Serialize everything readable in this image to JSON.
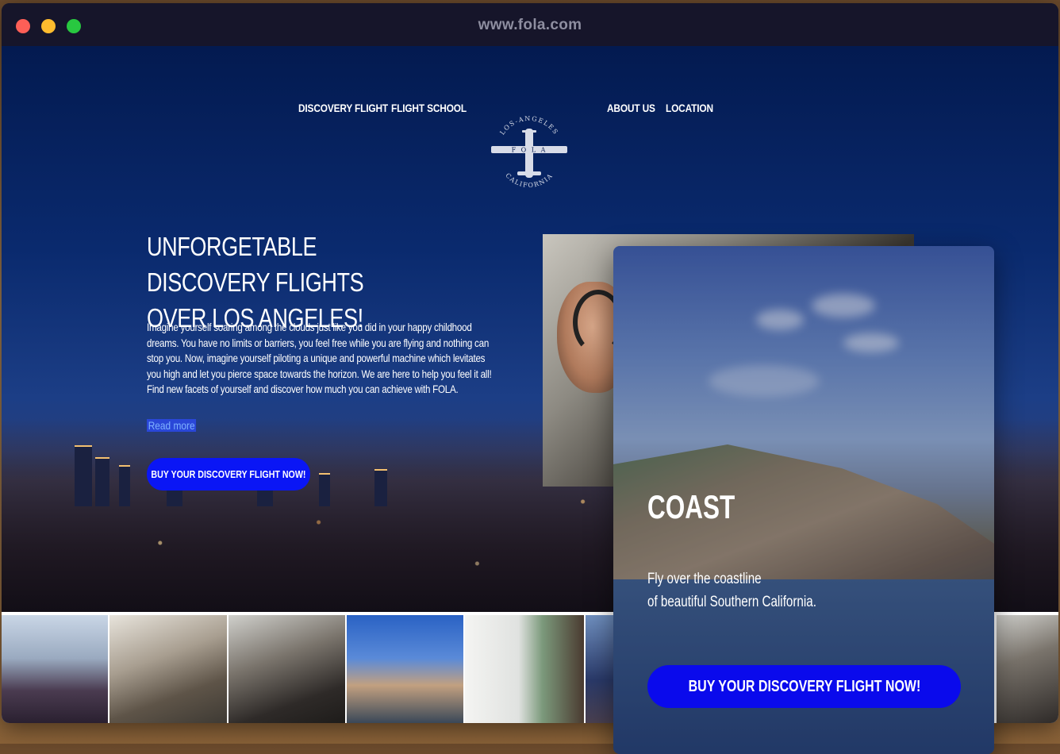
{
  "browser": {
    "url": "www.fola.com"
  },
  "nav": {
    "items": [
      "DISCOVERY FLIGHT",
      "FLIGHT SCHOOL",
      "ABOUT US",
      "LOCATION"
    ]
  },
  "logo": {
    "top_text": "LOS-ANGELES",
    "wing_text": "F O L A",
    "bottom_text": "CALIFORNIA"
  },
  "hero": {
    "title_line1": "UNFORGETABLE DISCOVERY FLIGHTS",
    "title_line2": "OVER LOS ANGELES!",
    "body": "Imagine yourself soaring among the clouds just like you did in your happy childhood dreams. You have no limits or barriers, you feel free while you are flying and nothing can stop you. Now, imagine yourself piloting a unique and powerful machine which levitates you high and let you pierce space towards the horizon. We are here to help you feel it all! Find new facets of yourself and discover how much you can achieve with FOLA.",
    "read_more": "Read more",
    "cta": "BUY YOUR DISCOVERY FLIGHT NOW!"
  },
  "card": {
    "title": "COAST",
    "text_line1": "Fly over the coastline",
    "text_line2": "of beautiful Southern California.",
    "cta": "BUY YOUR DISCOVERY FLIGHT NOW!"
  },
  "colors": {
    "accent": "#0a0aec",
    "nav_bg": "#031a50",
    "titlebar": "#16152a"
  }
}
